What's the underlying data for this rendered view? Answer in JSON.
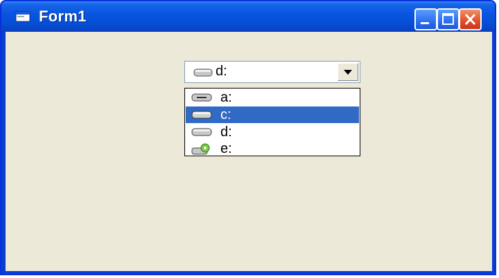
{
  "window": {
    "title": "Form1"
  },
  "combo": {
    "value": "d:",
    "icon": "drive-icon"
  },
  "dropdown": {
    "items": [
      {
        "label": "a:",
        "icon": "floppy-drive-icon"
      },
      {
        "label": "c:",
        "icon": "hard-drive-icon",
        "selected": true
      },
      {
        "label": "d:",
        "icon": "hard-drive-icon"
      },
      {
        "label": "e:",
        "icon": "cd-drive-icon"
      }
    ]
  },
  "colors": {
    "titlebar": "#0a55e0",
    "client": "#ece9d8",
    "selection": "#316ac5"
  }
}
